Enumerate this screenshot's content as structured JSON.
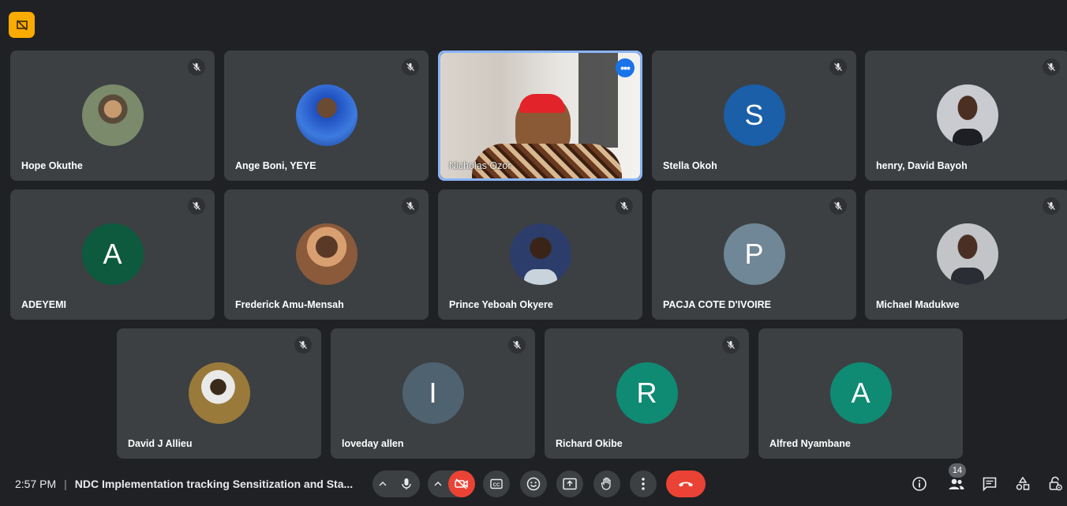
{
  "participants": [
    {
      "name": "Hope Okuthe",
      "initial": "",
      "muted": true,
      "photo": true,
      "color": "#5a6a4a"
    },
    {
      "name": "Ange Boni, YEYE",
      "initial": "",
      "muted": true,
      "photo": true,
      "color": "#2a5fc8"
    },
    {
      "name": "Nicholas Ozor",
      "initial": "",
      "muted": false,
      "photo": false,
      "video": true
    },
    {
      "name": "Stella Okoh",
      "initial": "S",
      "muted": true,
      "color": "#1a5fa8"
    },
    {
      "name": "henry, David Bayoh",
      "initial": "",
      "muted": true,
      "photo": true,
      "color": "#c9cbd0"
    },
    {
      "name": "ADEYEMI",
      "initial": "A",
      "muted": true,
      "color": "#0d5a3f"
    },
    {
      "name": "Frederick Amu-Mensah",
      "initial": "",
      "muted": true,
      "photo": true,
      "color": "#8a5a3a"
    },
    {
      "name": "Prince Yeboah Okyere",
      "initial": "",
      "muted": true,
      "photo": true,
      "color": "#2c3d6b"
    },
    {
      "name": "PACJA COTE D'IVOIRE",
      "initial": "P",
      "muted": true,
      "color": "#6f8797"
    },
    {
      "name": "Michael Madukwe",
      "initial": "",
      "muted": true,
      "photo": true,
      "color": "#c2c4c8"
    },
    {
      "name": "David J Allieu",
      "initial": "",
      "muted": true,
      "photo": true,
      "color": "#9a7a3a"
    },
    {
      "name": "loveday allen",
      "initial": "I",
      "muted": true,
      "color": "#4f6270"
    },
    {
      "name": "Richard Okibe",
      "initial": "R",
      "muted": true,
      "color": "#0f8a73"
    },
    {
      "name": "Alfred Nyambane",
      "initial": "A",
      "muted": false,
      "color": "#0f8a73"
    }
  ],
  "bottom_bar": {
    "time": "2:57 PM",
    "separator": "|",
    "meeting_title": "NDC Implementation tracking Sensitization and Sta...",
    "participant_count": "14"
  },
  "colors": {
    "background": "#202124",
    "tile": "#3c4043",
    "danger": "#ea4335",
    "accent": "#8ab4f8",
    "badge": "#f9ab00"
  }
}
